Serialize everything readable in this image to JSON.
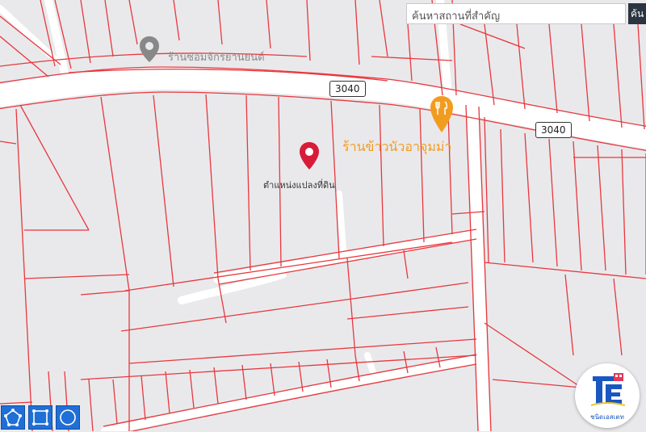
{
  "search": {
    "placeholder": "ค้นหาสถานที่สำคัญ",
    "button_label": "ค้น"
  },
  "roads": [
    {
      "ref": "3040"
    },
    {
      "ref": "3040"
    }
  ],
  "pois": [
    {
      "name": "ร้านซ่อมจักรยานยนต์",
      "icon": "location-pin-icon",
      "color": "#888888"
    },
    {
      "name": "ร้านข้าวนัวอาจุมม่า",
      "icon": "restaurant-icon",
      "color": "#f29c1f"
    }
  ],
  "marker": {
    "label": "ตำแหน่งแปลงที่ดิน",
    "icon": "map-marker-icon",
    "color": "#d81b36"
  },
  "tools": [
    {
      "name": "polygon-tool",
      "icon": "polygon-icon"
    },
    {
      "name": "rectangle-tool",
      "icon": "rectangle-icon"
    },
    {
      "name": "circle-tool",
      "icon": "circle-icon"
    }
  ],
  "logo": {
    "text": "ชนิดเอสเตท",
    "icon": "estate-logo-icon"
  },
  "colors": {
    "parcel_lines": "#e8383d",
    "road": "#ffffff",
    "background": "#e9e9ec"
  }
}
